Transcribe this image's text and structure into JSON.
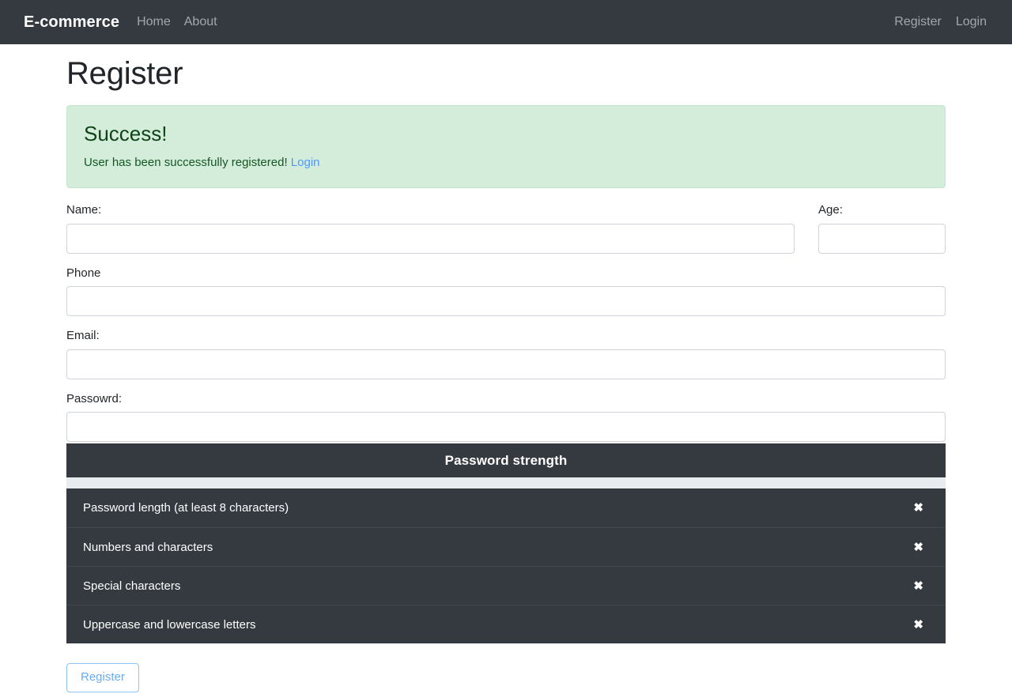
{
  "navbar": {
    "brand": "E-commerce",
    "left_links": [
      {
        "label": "Home",
        "name": "nav-link-home"
      },
      {
        "label": "About",
        "name": "nav-link-about"
      }
    ],
    "right_links": [
      {
        "label": "Register",
        "name": "nav-link-register"
      },
      {
        "label": "Login",
        "name": "nav-link-login"
      }
    ],
    "colors": {
      "background": "#343a40",
      "brand_text": "#ffffff",
      "link_text": "rgba(255,255,255,0.55)"
    }
  },
  "page": {
    "title": "Register"
  },
  "alert": {
    "heading": "Success!",
    "message": "User has been successfully registered!",
    "link_label": "Login",
    "colors": {
      "background": "#d4edda",
      "border": "#c3e6cb",
      "text": "#155724",
      "link": "#4c9aff"
    }
  },
  "form": {
    "fields": {
      "name": {
        "label": "Name:",
        "value": "",
        "placeholder": ""
      },
      "age": {
        "label": "Age:",
        "value": "",
        "placeholder": ""
      },
      "phone": {
        "label": "Phone",
        "value": "",
        "placeholder": ""
      },
      "email": {
        "label": "Email:",
        "value": "",
        "placeholder": ""
      },
      "password": {
        "label": "Passowrd:",
        "value": "",
        "placeholder": ""
      }
    },
    "submit_label": "Register"
  },
  "password_strength": {
    "header": "Password strength",
    "progress_percent": 0,
    "progress_track_color": "#e9ecef",
    "panel_color": "#343a40",
    "requirements": [
      {
        "label": "Password length (at least 8 characters)",
        "mark": "✖",
        "met": false
      },
      {
        "label": "Numbers and characters",
        "mark": "✖",
        "met": false
      },
      {
        "label": "Special characters",
        "mark": "✖",
        "met": false
      },
      {
        "label": "Uppercase and lowercase letters",
        "mark": "✖",
        "met": false
      }
    ]
  }
}
